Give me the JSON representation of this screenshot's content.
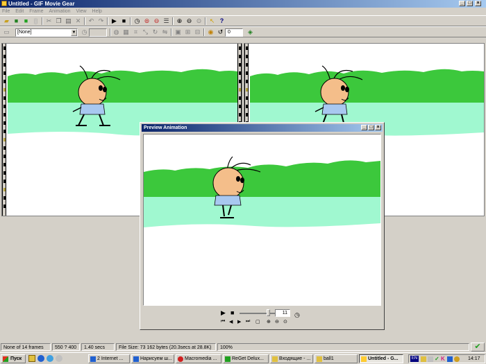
{
  "window": {
    "title": "Untitled - GIF Movie Gear"
  },
  "menu": [
    "File",
    "Edit",
    "Frame",
    "Animation",
    "View",
    "Help"
  ],
  "toolbar2": {
    "frame_select": "[None]",
    "loop_count": "0"
  },
  "preview": {
    "title": "Preview Animation",
    "frame_number": "11"
  },
  "status": {
    "frames": "None of 14 frames",
    "dimensions": "550 ? 400",
    "duration": "1.40 secs",
    "file_size": "File Size: 73 162 bytes  (20.3secs at 28.8K)",
    "zoom": "100%"
  },
  "taskbar": {
    "start": "Пуск",
    "tasks": [
      "2 Internet ...",
      "Нарисуем ш...",
      "Macromedia ...",
      "ReGet Delux...",
      "Входящие - ...",
      "ball1",
      "Untitled - G..."
    ],
    "lang": "EN",
    "clock": "14:17"
  },
  "colors": {
    "grass": "#3cc83c",
    "water": "#a0f8d0",
    "skin": "#f4be8a",
    "shirt": "#a8c8f0",
    "titlebar": "#0a246a"
  }
}
